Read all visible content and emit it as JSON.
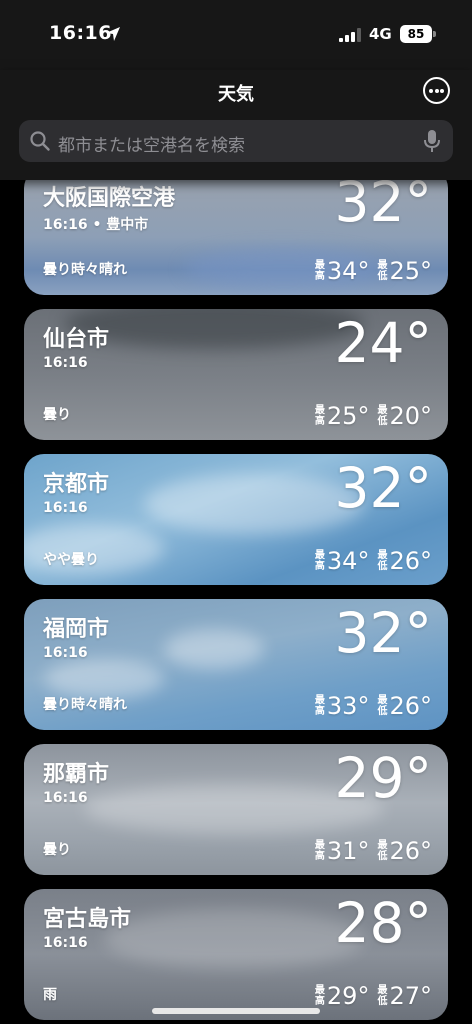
{
  "status": {
    "time": "16:16",
    "network": "4G",
    "battery": "85"
  },
  "nav": {
    "title": "天気"
  },
  "search": {
    "placeholder": "都市または空港名を検索"
  },
  "labels": {
    "high": [
      "最",
      "高"
    ],
    "low": [
      "最",
      "低"
    ]
  },
  "cities": [
    {
      "name": "大阪国際空港",
      "time": "16:16 • 豊中市",
      "temp": "32°",
      "condition": "曇り時々晴れ",
      "high": "34°",
      "low": "25°"
    },
    {
      "name": "仙台市",
      "time": "16:16",
      "temp": "24°",
      "condition": "曇り",
      "high": "25°",
      "low": "20°"
    },
    {
      "name": "京都市",
      "time": "16:16",
      "temp": "32°",
      "condition": "やや曇り",
      "high": "34°",
      "low": "26°"
    },
    {
      "name": "福岡市",
      "time": "16:16",
      "temp": "32°",
      "condition": "曇り時々晴れ",
      "high": "33°",
      "low": "26°"
    },
    {
      "name": "那覇市",
      "time": "16:16",
      "temp": "29°",
      "condition": "曇り",
      "high": "31°",
      "low": "26°"
    },
    {
      "name": "宮古島市",
      "time": "16:16",
      "temp": "28°",
      "condition": "雨",
      "high": "29°",
      "low": "27°"
    }
  ]
}
